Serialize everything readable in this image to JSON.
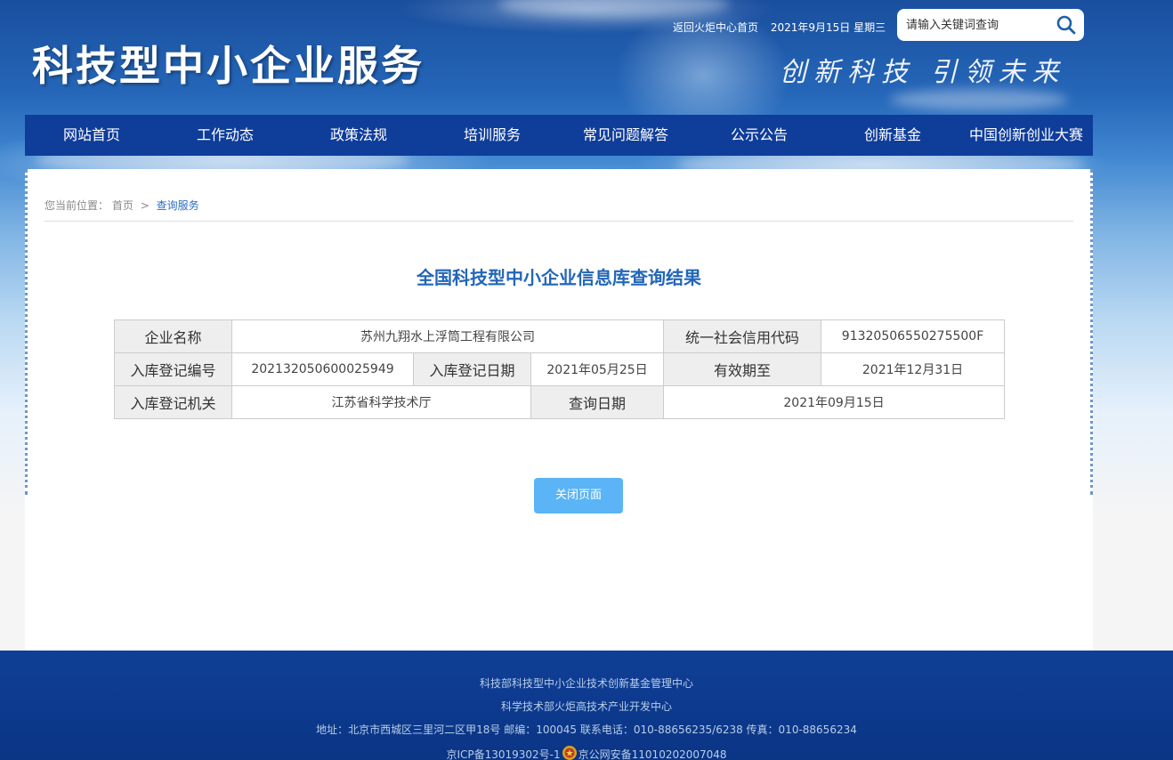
{
  "header": {
    "site_title": "科技型中小企业服务",
    "back_link": "返回火炬中心首页",
    "date": "2021年9月15日 星期三",
    "search_placeholder": "请输入关键词查询",
    "slogan": "创新科技 引领未来"
  },
  "nav": {
    "items": [
      {
        "label": "网站首页"
      },
      {
        "label": "工作动态"
      },
      {
        "label": "政策法规"
      },
      {
        "label": "培训服务"
      },
      {
        "label": "常见问题解答"
      },
      {
        "label": "公示公告"
      },
      {
        "label": "创新基金"
      },
      {
        "label": "中国创新创业大赛"
      }
    ]
  },
  "breadcrumb": {
    "prefix": "您当前位置：",
    "home": "首页",
    "separator": ">",
    "current": "查询服务"
  },
  "main": {
    "title": "全国科技型中小企业信息库查询结果",
    "table": {
      "company_name_label": "企业名称",
      "company_name": "苏州九翔水上浮筒工程有限公司",
      "credit_code_label": "统一社会信用代码",
      "credit_code": "91320506550275500F",
      "reg_no_label": "入库登记编号",
      "reg_no": "202132050600025949",
      "reg_date_label": "入库登记日期",
      "reg_date": "2021年05月25日",
      "valid_until_label": "有效期至",
      "valid_until": "2021年12月31日",
      "reg_authority_label": "入库登记机关",
      "reg_authority": "江苏省科学技术厅",
      "query_date_label": "查询日期",
      "query_date": "2021年09月15日"
    },
    "close_button": "关闭页面"
  },
  "footer": {
    "line1": "科技部科技型中小企业技术创新基金管理中心",
    "line2": "科学技术部火炬高技术产业开发中心",
    "line3": "地址：北京市西城区三里河二区甲18号 邮编：100045 联系电话：010-88656235/6238 传真：010-88656234",
    "icp": "京ICP备13019302号-1",
    "police": "京公网安备11010202007048"
  },
  "colors": {
    "nav_bg": "#0f3d9a",
    "title_blue": "#2266b8",
    "button_blue": "#5ab4f5",
    "footer_bg": "#0f3f96"
  },
  "icons": {
    "search": "search-icon",
    "police": "police-badge-icon"
  }
}
